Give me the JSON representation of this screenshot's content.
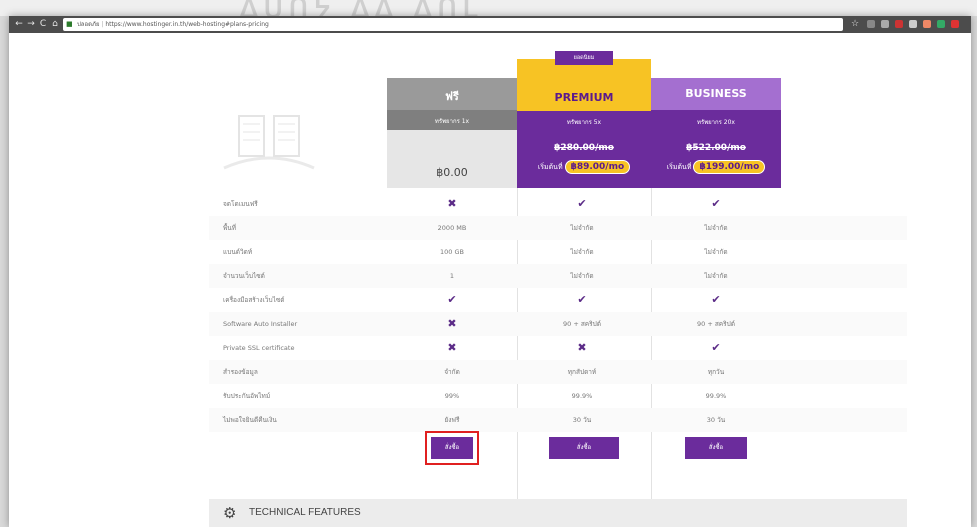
{
  "watermark": "ᐃᑌᑎᔭ ᐃᐃ ᐃᑎᒪ",
  "browser": {
    "url_prefix": "ปลอดภัย",
    "url": "https://www.hostinger.in.th/web-hosting#plans-pricing",
    "back_icon": "←",
    "forward_icon": "→",
    "reload_icon": "C",
    "home_icon": "⌂",
    "star_icon": "☆"
  },
  "plans": [
    {
      "name": "ฟรี",
      "sub": "ทรัพยากร 1x",
      "old_price": "",
      "price_prefix": "",
      "price": "฿0.00"
    },
    {
      "name": "PREMIUM",
      "badge": "ยอดนิยม",
      "sub": "ทรัพยากร 5x",
      "old_price": "฿280.00/mo",
      "price_prefix": "เริ่มต้นที่",
      "price": "฿89.00/mo"
    },
    {
      "name": "BUSINESS",
      "sub": "ทรัพยากร 20x",
      "old_price": "฿522.00/mo",
      "price_prefix": "เริ่มต้นที่",
      "price": "฿199.00/mo"
    }
  ],
  "rows": [
    {
      "label": "จดโดเมนฟรี",
      "values": [
        "✖",
        "✔",
        "✔"
      ]
    },
    {
      "label": "พื้นที่",
      "values": [
        "2000 MB",
        "ไม่จำกัด",
        "ไม่จำกัด"
      ]
    },
    {
      "label": "แบนด์วิดท์",
      "values": [
        "100 GB",
        "ไม่จำกัด",
        "ไม่จำกัด"
      ]
    },
    {
      "label": "จำนวนเว็บไซต์",
      "values": [
        "1",
        "ไม่จำกัด",
        "ไม่จำกัด"
      ]
    },
    {
      "label": "เครื่องมือสร้างเว็บไซต์",
      "values": [
        "✔",
        "✔",
        "✔"
      ]
    },
    {
      "label": "Software Auto Installer",
      "values": [
        "✖",
        "90 + สคริปต์",
        "90 + สคริปต์"
      ]
    },
    {
      "label": "Private SSL certificate",
      "values": [
        "✖",
        "✖",
        "✔"
      ]
    },
    {
      "label": "สำรองข้อมูล",
      "values": [
        "จำกัด",
        "ทุกสัปดาห์",
        "ทุกวัน"
      ]
    },
    {
      "label": "รับประกันอัพไทม์",
      "values": [
        "99%",
        "99.9%",
        "99.9%"
      ]
    },
    {
      "label": "ไม่พอใจยินดีคืนเงิน",
      "values": [
        "ยังฟรี",
        "30 วัน",
        "30 วัน"
      ]
    }
  ],
  "order_label": "สั่งซื้อ",
  "technical": {
    "title": "TECHNICAL FEATURES",
    "icon": "gear-icon"
  },
  "colors": {
    "purple": "#6b2c9c",
    "yellow": "#f7c324",
    "grey_header": "#9a9a9a",
    "highlight": "#e02020"
  }
}
